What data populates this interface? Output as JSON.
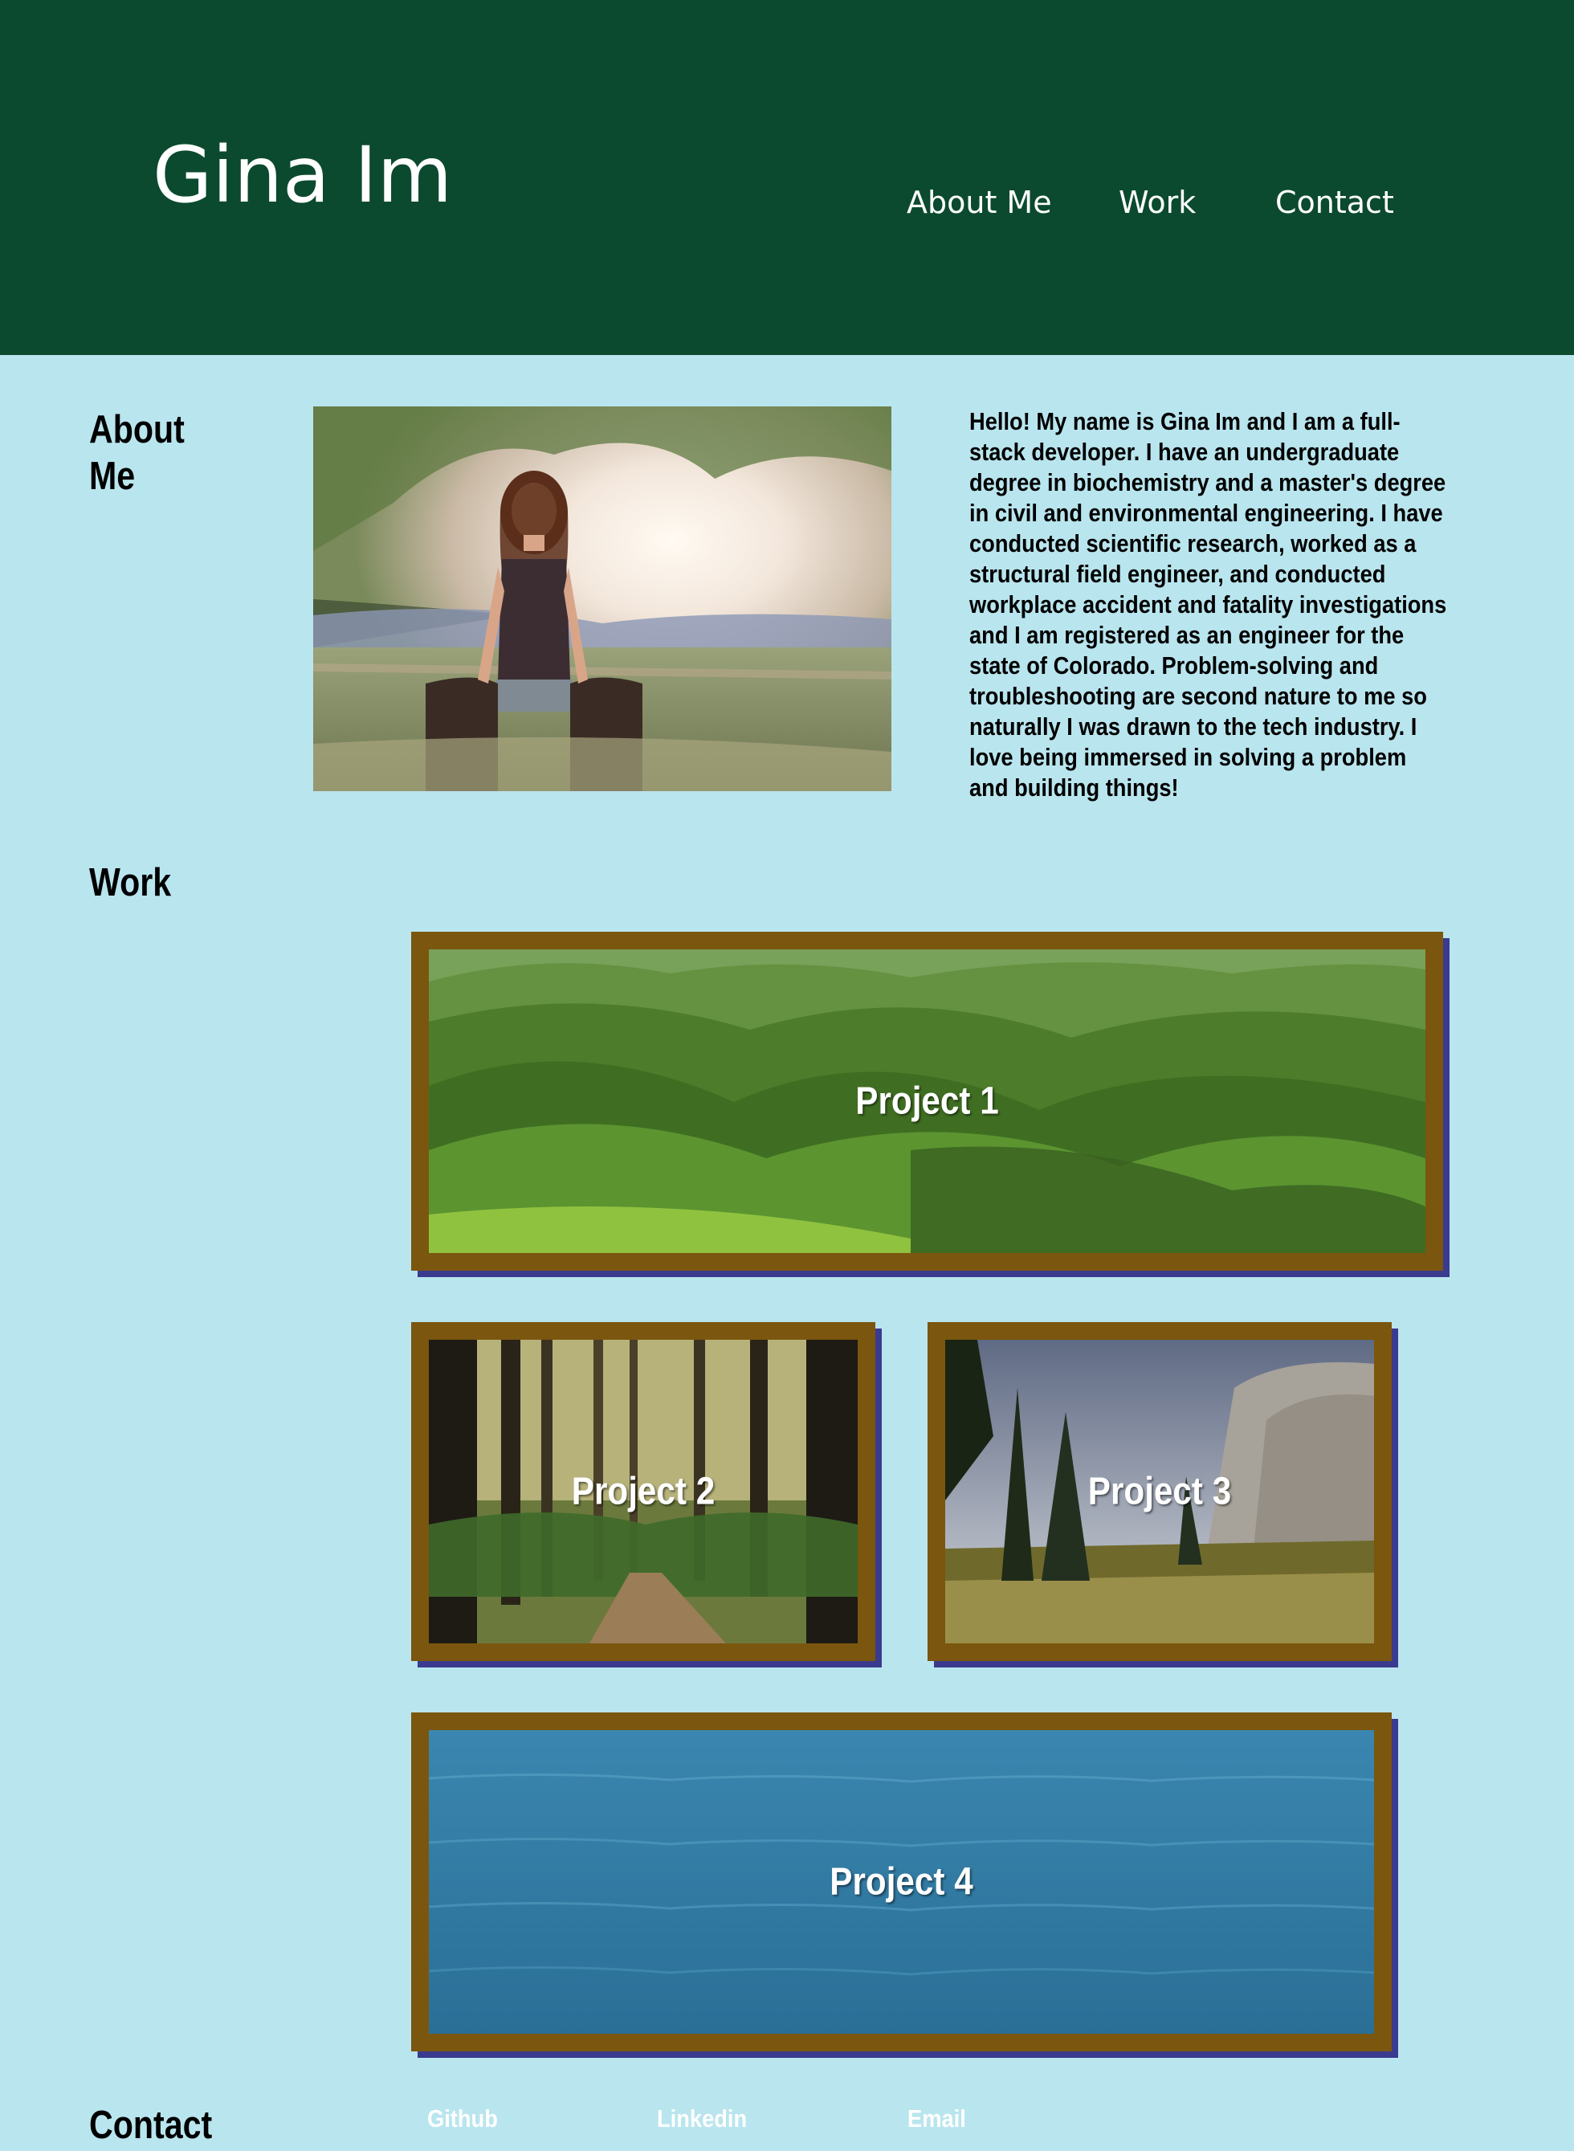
{
  "header": {
    "title": "Gina Im",
    "nav": [
      "About Me",
      "Work",
      "Contact"
    ]
  },
  "about": {
    "heading_line1": "About",
    "heading_line2": "Me",
    "photo_icon": "portrait-photo",
    "bio": "Hello! My name is Gina Im and I am a full-stack developer. I have an undergraduate degree in biochemistry and a master's degree in civil and environmental engineering. I have conducted scientific research, worked as a structural field engineer, and conducted workplace accident and fatality investigations and I am registered as an engineer for the state of Colorado. Problem-solving and troubleshooting are second nature to me so naturally I was drawn to the tech industry. I love being immersed in solving a problem and building things!"
  },
  "work": {
    "heading": "Work",
    "projects": [
      {
        "label": "Project 1",
        "image": "green-hills"
      },
      {
        "label": "Project 2",
        "image": "forest-path"
      },
      {
        "label": "Project 3",
        "image": "mountain-cliff"
      },
      {
        "label": "Project 4",
        "image": "ocean-water"
      }
    ]
  },
  "contact": {
    "heading": "Contact",
    "links": [
      "Github",
      "Linkedin",
      "Email"
    ]
  },
  "colors": {
    "header_bg": "#0b4a2e",
    "page_bg": "#b9e5ee",
    "frame": "#7b560e",
    "frame_shadow": "#3a3a8e"
  }
}
